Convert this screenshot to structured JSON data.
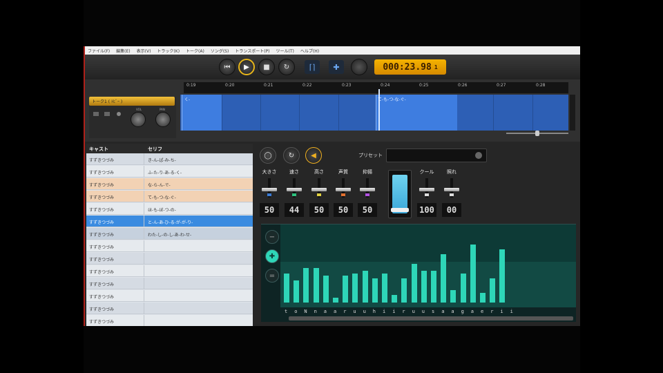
{
  "menu": [
    "ファイル(F)",
    "編集(E)",
    "表示(V)",
    "トラック(K)",
    "トーク(A)",
    "ソング(S)",
    "トランスポート(P)",
    "ツール(T)",
    "ヘルプ(H)"
  ],
  "transport": {
    "skip_back": "⏮",
    "play": "▶",
    "stop": "■",
    "loop": "↻",
    "bracket": "⌈⌉",
    "snap": "✚",
    "timecode": "000:23.98",
    "timecode_suffix": "1"
  },
  "timeline": {
    "ticks": [
      "0:19",
      "0:20",
      "0:21",
      "0:22",
      "0:23",
      "0:24",
      "0:25",
      "0:26",
      "0:27",
      "0:28"
    ],
    "track_name": "トーク1 ( ﾄﾋﾞｰ )",
    "knob_vol": "VOL",
    "knob_pan": "PAN",
    "clip_texts": [
      "く-",
      "て-も-つ-な-ぐ-"
    ]
  },
  "table": {
    "header_cast": "キャスト",
    "header_line": "セリフ",
    "rows": [
      {
        "cast": "すずきつづみ",
        "line": "き-ん-ぱ-み-ち-",
        "style": "even"
      },
      {
        "cast": "すずきつづみ",
        "line": "ふ-た-り-あ-る-く-",
        "style": "odd"
      },
      {
        "cast": "すずきつづみ",
        "line": "な-ら-ん-で-",
        "style": "orange"
      },
      {
        "cast": "すずきつづみ",
        "line": "て-も-つ-な-ぐ-",
        "style": "orange"
      },
      {
        "cast": "すずきつづみ",
        "line": "ほ-も-ぼ-つ-の-",
        "style": "odd"
      },
      {
        "cast": "すずきつづみ",
        "line": "と-ん-あ-ひ-る-が-が-り-",
        "style": "selected"
      },
      {
        "cast": "すずきつづみ",
        "line": "わた-し-の-し-あ-わ-せ-",
        "style": "blue"
      },
      {
        "cast": "すずきつづみ",
        "line": "",
        "style": "odd"
      },
      {
        "cast": "すずきつづみ",
        "line": "",
        "style": "even"
      },
      {
        "cast": "すずきつづみ",
        "line": "",
        "style": "odd"
      },
      {
        "cast": "すずきつづみ",
        "line": "",
        "style": "even"
      },
      {
        "cast": "すずきつづみ",
        "line": "",
        "style": "odd"
      },
      {
        "cast": "すずきつづみ",
        "line": "",
        "style": "even"
      },
      {
        "cast": "すずきつづみ",
        "line": "",
        "style": "odd"
      }
    ]
  },
  "panel": {
    "preset_label": "プリセット",
    "params": [
      {
        "label": "大きさ",
        "value": "50",
        "led": "#3a7bd5"
      },
      {
        "label": "速さ",
        "value": "44",
        "led": "#2ec27e"
      },
      {
        "label": "高さ",
        "value": "50",
        "led": "#e0d040"
      },
      {
        "label": "声質",
        "value": "50",
        "led": "#e07030"
      },
      {
        "label": "抑揚",
        "value": "50",
        "led": "#b050e0"
      },
      {
        "label": "クール",
        "value": "100",
        "led": "#dddddd"
      },
      {
        "label": "照れ",
        "value": "00",
        "led": "#dddddd"
      }
    ],
    "phonemes": [
      "t",
      "o",
      "N",
      "n",
      "a",
      "a",
      "r",
      "u",
      "u",
      "h",
      "i",
      "i",
      "r",
      "u",
      "u",
      "s",
      "a",
      "a",
      "g",
      "a",
      "e",
      "r",
      "i",
      "i"
    ],
    "levels": [
      0.6,
      0.45,
      0.72,
      0.72,
      0.55,
      0.1,
      0.55,
      0.6,
      0.65,
      0.5,
      0.6,
      0.15,
      0.5,
      0.8,
      0.65,
      0.65,
      1.0,
      0.25,
      0.6,
      1.2,
      0.2,
      0.5,
      1.1,
      0.0
    ]
  }
}
